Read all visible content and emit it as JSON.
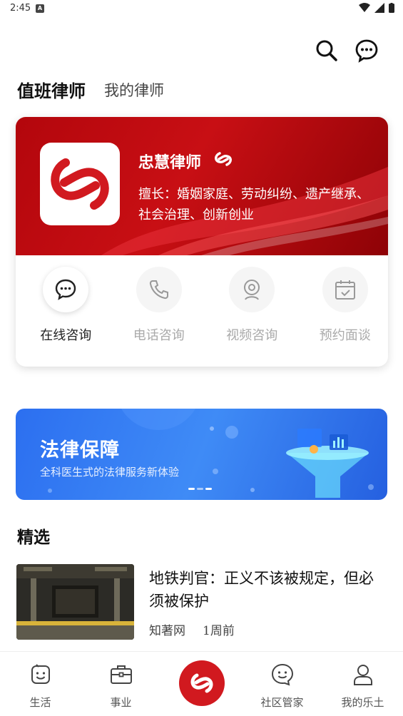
{
  "status_bar": {
    "time": "2:45",
    "notification_icon": "A"
  },
  "header": {
    "search_icon": "search-icon",
    "message_icon": "chat-bubble-icon"
  },
  "tabs": [
    {
      "label": "值班律师",
      "active": true
    },
    {
      "label": "我的律师",
      "active": false
    }
  ],
  "lawyer_card": {
    "name": "忠慧律师",
    "specialty": "擅长：婚姻家庭、劳动纠纷、遗产继承、社会治理、创新创业",
    "services": [
      {
        "label": "在线咨询",
        "icon": "chat-icon",
        "active": true
      },
      {
        "label": "电话咨询",
        "icon": "phone-icon",
        "active": false
      },
      {
        "label": "视频咨询",
        "icon": "webcam-icon",
        "active": false
      },
      {
        "label": "预约面谈",
        "icon": "calendar-check-icon",
        "active": false
      }
    ]
  },
  "banner": {
    "title": "法律保障",
    "subtitle": "全科医生式的法律服务新体验"
  },
  "featured": {
    "section_title": "精选",
    "articles": [
      {
        "title": "地铁判官：正义不该被规定，但必须被保护",
        "source": "知著网",
        "time": "1周前"
      }
    ]
  },
  "bottom_nav": [
    {
      "label": "生活",
      "icon": "smile-icon"
    },
    {
      "label": "事业",
      "icon": "briefcase-icon"
    },
    {
      "label": "",
      "icon": "brand-logo-icon"
    },
    {
      "label": "社区管家",
      "icon": "face-bubble-icon"
    },
    {
      "label": "我的乐土",
      "icon": "user-icon"
    }
  ],
  "colors": {
    "brand_red": "#d1191f",
    "banner_blue": "#2c6ff0"
  }
}
